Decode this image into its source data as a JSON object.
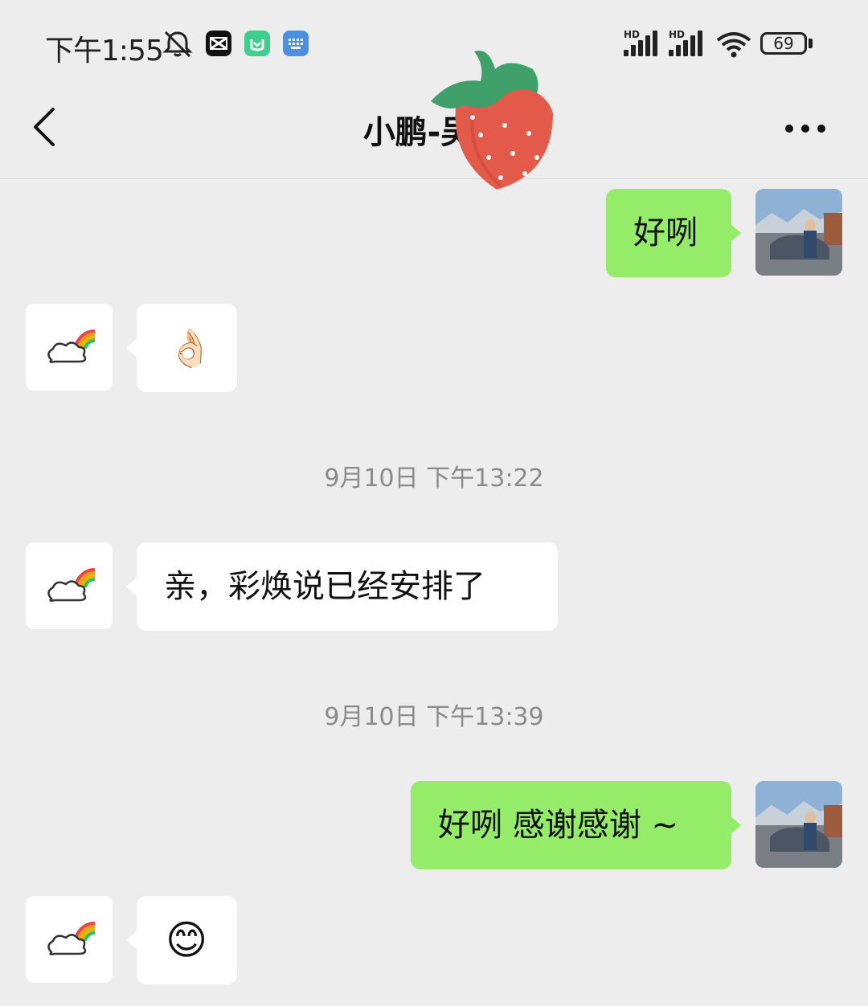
{
  "status_bar": {
    "time": "下午1:55",
    "signal1_label": "HD",
    "signal2_label": "HD",
    "battery": "69",
    "app_icons": [
      "mute-bell-icon",
      "capcut-icon",
      "mi-home-icon",
      "keyboard-icon"
    ]
  },
  "nav": {
    "title": "小鹏-吴育",
    "back_icon": "chevron-left-icon",
    "more_icon": "more-dots-icon"
  },
  "colors": {
    "background": "#ededed",
    "my_bubble": "#95ec69",
    "friend_bubble": "#ffffff",
    "timestamp": "#8a8a8a"
  },
  "messages": [
    {
      "sender": "me",
      "type": "text",
      "text": "好咧"
    },
    {
      "sender": "friend",
      "type": "emoji",
      "emoji": "👌🏻"
    },
    {
      "type": "timestamp",
      "text": "9月10日 下午13:22"
    },
    {
      "sender": "friend",
      "type": "text",
      "text": "亲，彩焕说已经安排了"
    },
    {
      "type": "timestamp",
      "text": "9月10日 下午13:39"
    },
    {
      "sender": "me",
      "type": "text",
      "text": "好咧 感谢感谢 ~"
    },
    {
      "sender": "friend",
      "type": "emoji",
      "emoji": "😊"
    }
  ]
}
